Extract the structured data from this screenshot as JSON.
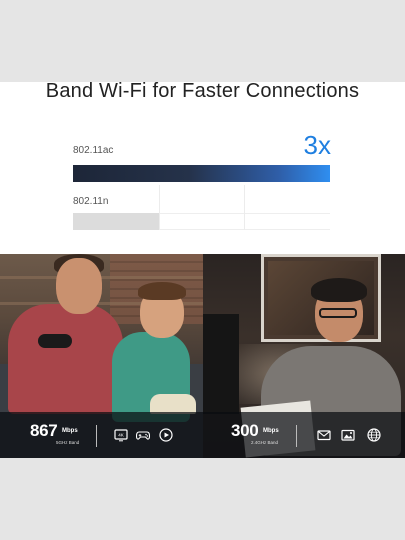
{
  "headline": "Band Wi-Fi for Faster Connections",
  "comparison": {
    "multiplier": "3x",
    "bars": [
      {
        "label": "802.11ac",
        "fraction": 1.0,
        "accent": "#2f8ef0"
      },
      {
        "label": "802.11n",
        "fraction": 0.333,
        "color": "#dcdcdc"
      }
    ]
  },
  "speed_strip": {
    "left": {
      "value": "867",
      "unit": "Mbps",
      "band": "5GHz Band",
      "icons": [
        "4k-video-icon",
        "gamepad-icon",
        "play-icon"
      ]
    },
    "right": {
      "value": "300",
      "unit": "Mbps",
      "band": "2.4GHz Band",
      "icons": [
        "mail-icon",
        "image-icon",
        "globe-icon"
      ]
    }
  },
  "colors": {
    "accent": "#1f7fe0",
    "strip_background": "#0a0c10"
  }
}
